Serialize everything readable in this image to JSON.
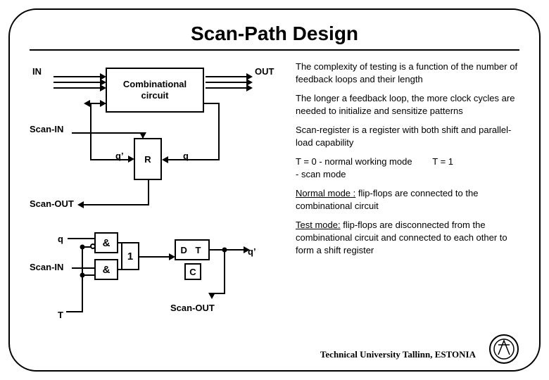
{
  "title": "Scan-Path Design",
  "labels": {
    "in": "IN",
    "out": "OUT",
    "scan_in": "Scan-IN",
    "scan_out": "Scan-OUT",
    "q": "q",
    "q_prime": "q’",
    "R": "R",
    "T": "T",
    "and": "&",
    "one": "1",
    "DT": "D  T",
    "C": "C",
    "combo": "Combinational circuit"
  },
  "notes": {
    "p1": "The complexity of testing is a function of the number of feedback loops and their length",
    "p2": "The longer a feedback loop, the more clock cycles are needed to initialize and sensitize patterns",
    "p3": "Scan-register is a register with both shift and parallel-load capability",
    "p4a": "T = 0  - normal working mode",
    "p4b": "T = 1",
    "p4c": "- scan mode",
    "p5a": "Normal mode :",
    "p5b": "  flip-flops are connected to the combinational circuit",
    "p6a": "Test mode:",
    "p6b": "  flip-flops are disconnected from the combinational circuit and connected to each other to form a shift register"
  },
  "footer": "Technical University Tallinn, ESTONIA"
}
